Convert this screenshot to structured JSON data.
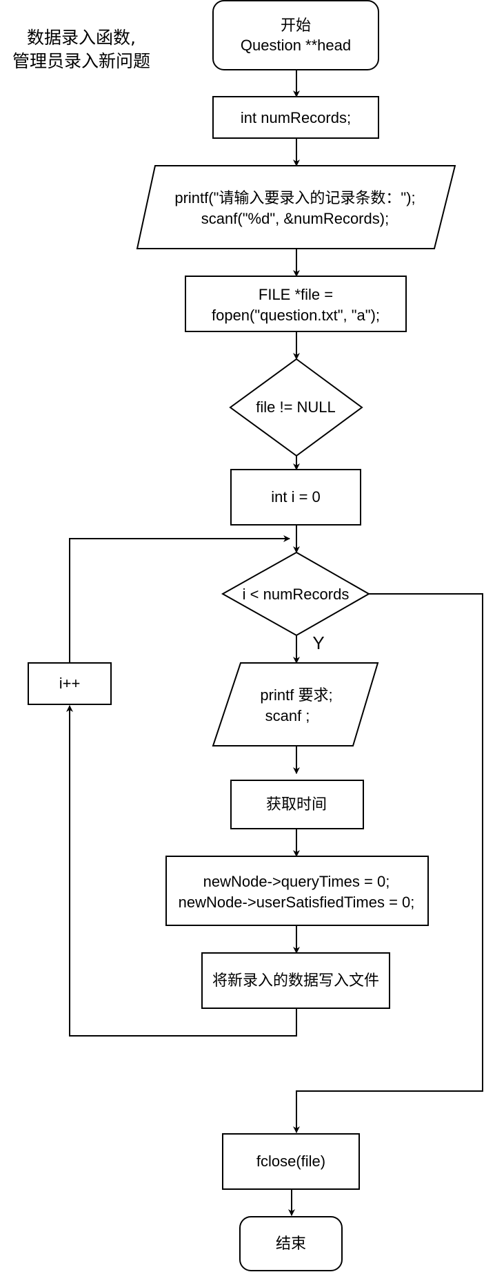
{
  "diagram": {
    "caption_lines": [
      "数据录入函数,",
      "管理员录入新问题"
    ],
    "nodes": {
      "start": [
        "开始",
        "Question **head"
      ],
      "declare_num": [
        "int numRecords;"
      ],
      "input_count": [
        "printf(\"请输入要录入的记录条数：\");",
        "scanf(\"%d\", &numRecords);"
      ],
      "open_file": [
        "FILE *file =",
        "fopen(\"question.txt\", \"a\");"
      ],
      "check_file": [
        "file != NULL"
      ],
      "init_i": [
        "int i = 0"
      ],
      "loop_cond": [
        "i < numRecords"
      ],
      "io_input": [
        "printf 要求;",
        "scanf ;"
      ],
      "get_time": [
        "获取时间"
      ],
      "init_counts": [
        "newNode->queryTimes = 0;",
        "newNode->userSatisfiedTimes = 0;"
      ],
      "write_file": [
        "将新录入的数据写入文件"
      ],
      "increment": [
        "i++"
      ],
      "close_file": [
        "fclose(file)"
      ],
      "end": [
        "结束"
      ]
    },
    "edge_labels": {
      "loop_yes": "Y"
    }
  }
}
